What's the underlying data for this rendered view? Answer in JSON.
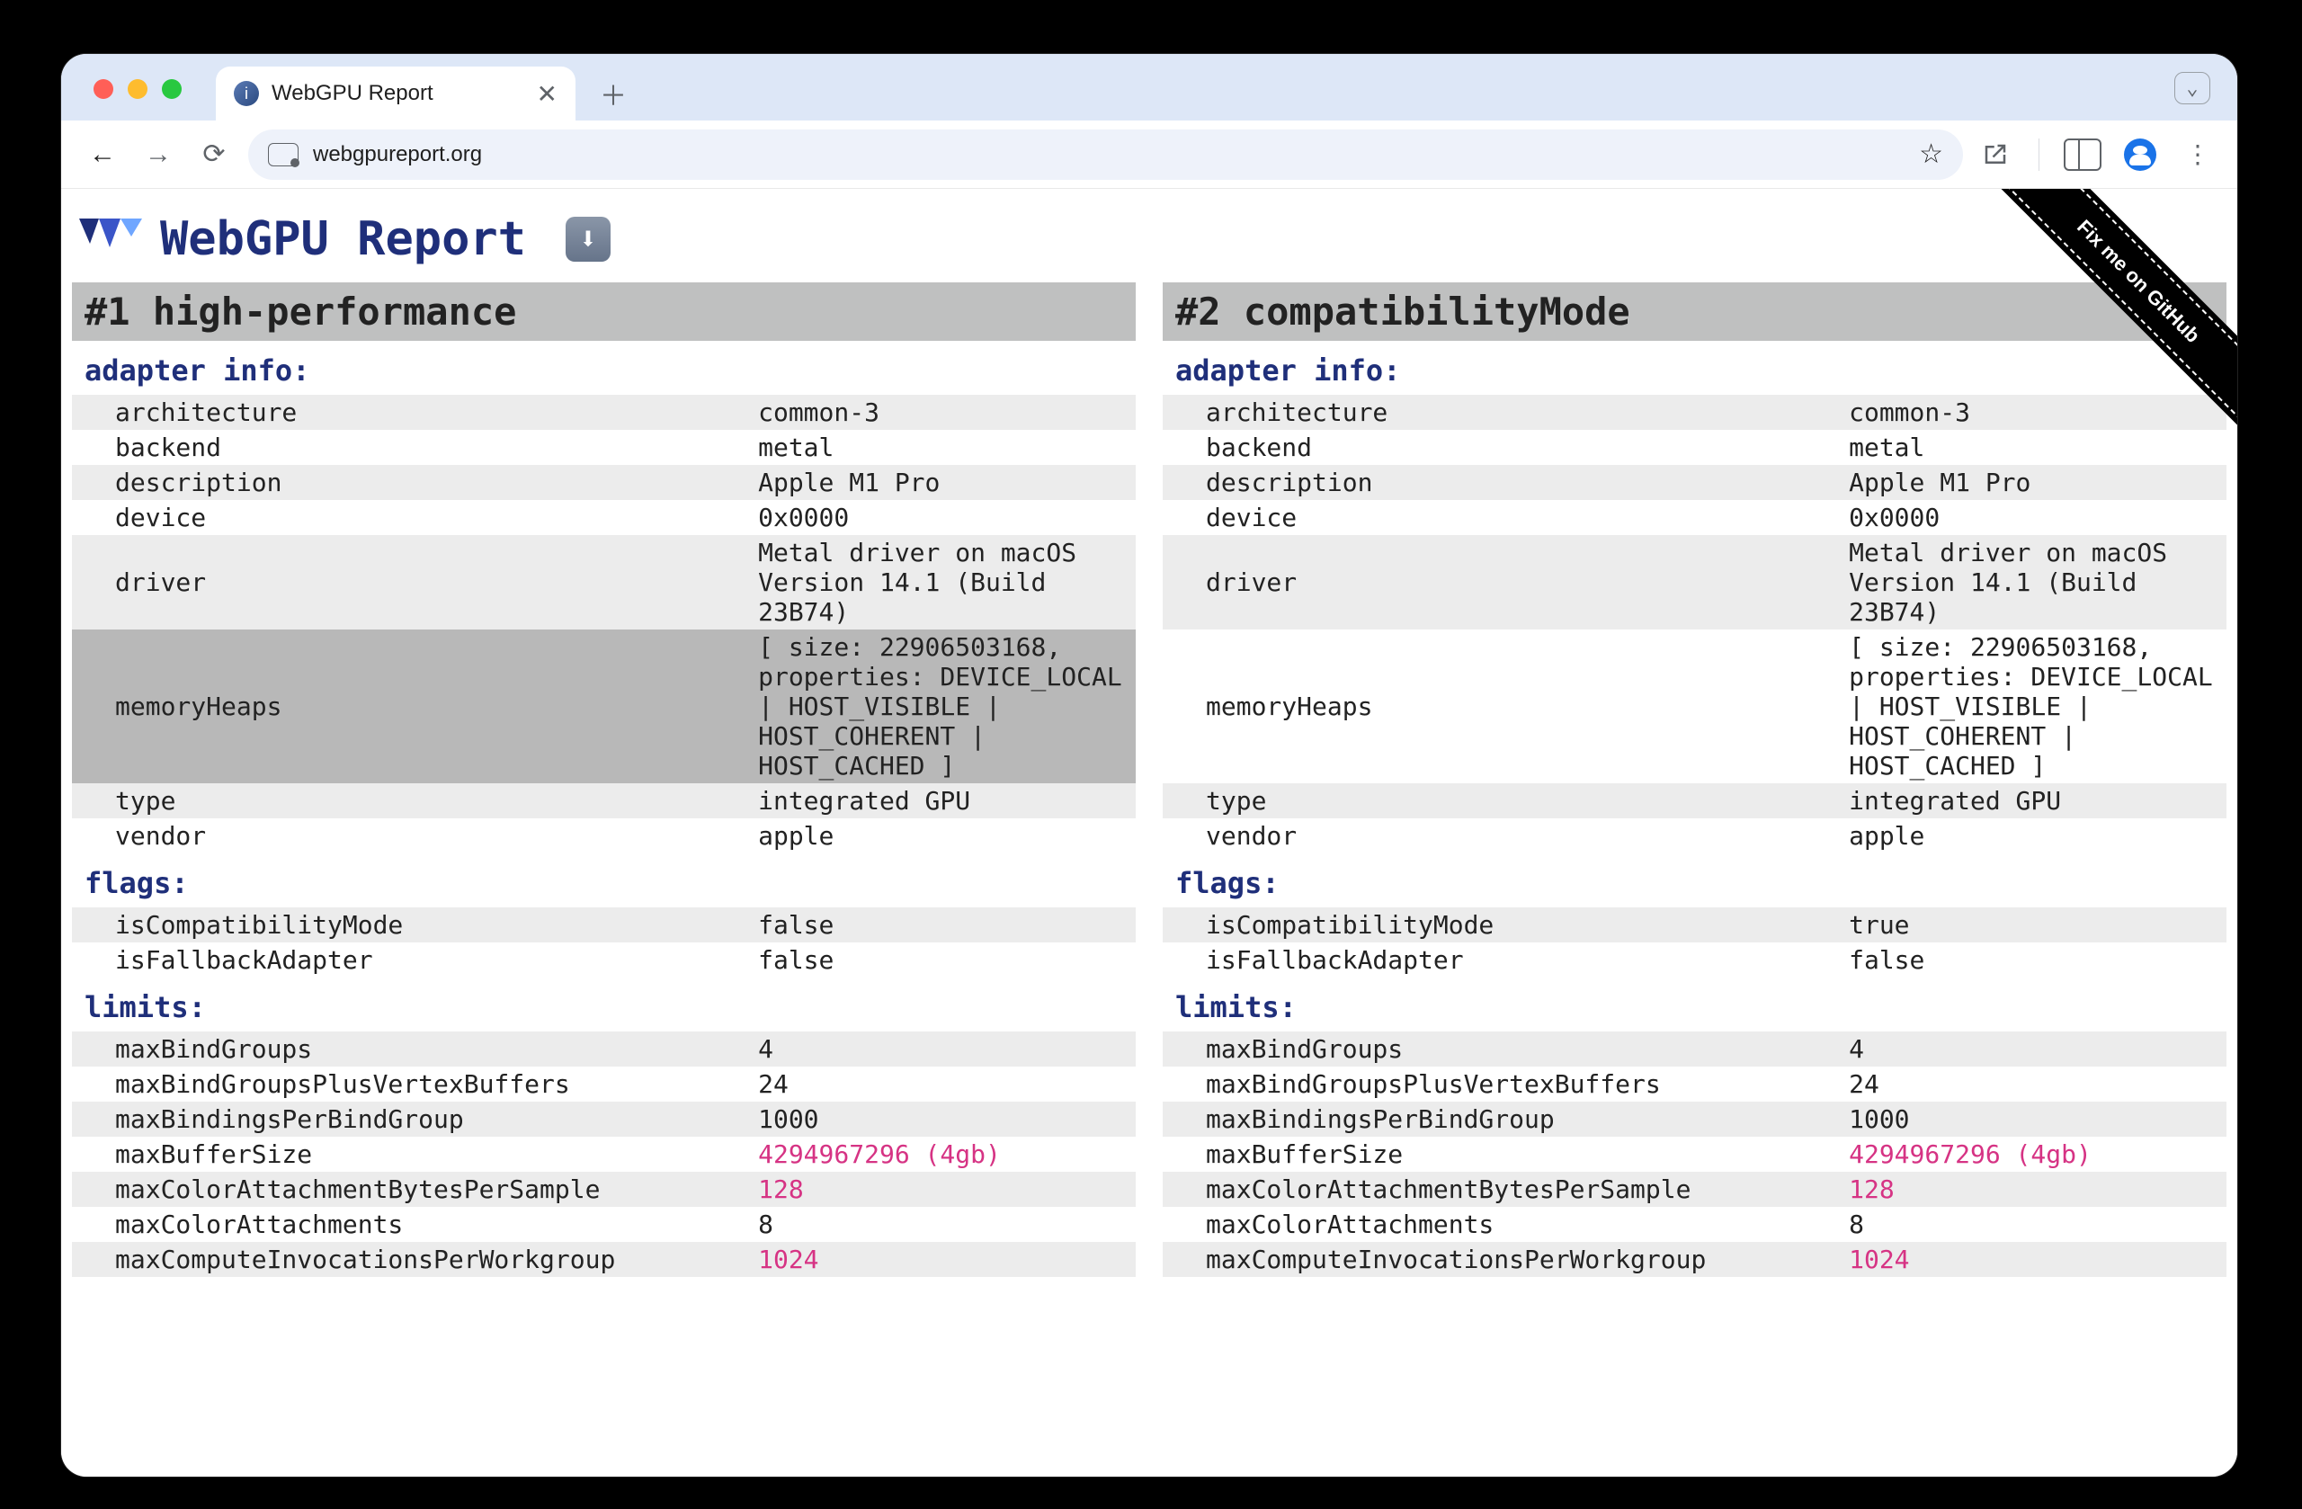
{
  "browser": {
    "tab_title": "WebGPU Report",
    "url": "webgpureport.org",
    "window_menu": "⌄"
  },
  "page": {
    "title": "WebGPU Report",
    "download_icon": "⬇",
    "ribbon": "Fix me on GitHub"
  },
  "columns": [
    {
      "header": "#1 high-performance",
      "sections": {
        "adapter_info_label": "adapter info:",
        "adapter_info": [
          {
            "k": "architecture",
            "v": "common-3"
          },
          {
            "k": "backend",
            "v": "metal"
          },
          {
            "k": "description",
            "v": "Apple M1 Pro"
          },
          {
            "k": "device",
            "v": "0x0000"
          },
          {
            "k": "driver",
            "v": "Metal driver on macOS Version 14.1 (Build 23B74)"
          },
          {
            "k": "memoryHeaps",
            "v": "[ size: 22906503168, properties: DEVICE_LOCAL | HOST_VISIBLE | HOST_COHERENT | HOST_CACHED ]",
            "hl": true
          },
          {
            "k": "type",
            "v": "integrated GPU"
          },
          {
            "k": "vendor",
            "v": "apple"
          }
        ],
        "flags_label": "flags:",
        "flags": [
          {
            "k": "isCompatibilityMode",
            "v": "false"
          },
          {
            "k": "isFallbackAdapter",
            "v": "false"
          }
        ],
        "limits_label": "limits:",
        "limits": [
          {
            "k": "maxBindGroups",
            "v": "4"
          },
          {
            "k": "maxBindGroupsPlusVertexBuffers",
            "v": "24"
          },
          {
            "k": "maxBindingsPerBindGroup",
            "v": "1000"
          },
          {
            "k": "maxBufferSize",
            "v": "4294967296 (4gb)",
            "pink": true
          },
          {
            "k": "maxColorAttachmentBytesPerSample",
            "v": "128",
            "pink": true
          },
          {
            "k": "maxColorAttachments",
            "v": "8"
          },
          {
            "k": "maxComputeInvocationsPerWorkgroup",
            "v": "1024",
            "pink": true
          }
        ]
      }
    },
    {
      "header": "#2 compatibilityMode",
      "sections": {
        "adapter_info_label": "adapter info:",
        "adapter_info": [
          {
            "k": "architecture",
            "v": "common-3"
          },
          {
            "k": "backend",
            "v": "metal"
          },
          {
            "k": "description",
            "v": "Apple M1 Pro"
          },
          {
            "k": "device",
            "v": "0x0000"
          },
          {
            "k": "driver",
            "v": "Metal driver on macOS Version 14.1 (Build 23B74)"
          },
          {
            "k": "memoryHeaps",
            "v": "[ size: 22906503168, properties: DEVICE_LOCAL | HOST_VISIBLE | HOST_COHERENT | HOST_CACHED ]"
          },
          {
            "k": "type",
            "v": "integrated GPU"
          },
          {
            "k": "vendor",
            "v": "apple"
          }
        ],
        "flags_label": "flags:",
        "flags": [
          {
            "k": "isCompatibilityMode",
            "v": "true"
          },
          {
            "k": "isFallbackAdapter",
            "v": "false"
          }
        ],
        "limits_label": "limits:",
        "limits": [
          {
            "k": "maxBindGroups",
            "v": "4"
          },
          {
            "k": "maxBindGroupsPlusVertexBuffers",
            "v": "24"
          },
          {
            "k": "maxBindingsPerBindGroup",
            "v": "1000"
          },
          {
            "k": "maxBufferSize",
            "v": "4294967296 (4gb)",
            "pink": true
          },
          {
            "k": "maxColorAttachmentBytesPerSample",
            "v": "128",
            "pink": true
          },
          {
            "k": "maxColorAttachments",
            "v": "8"
          },
          {
            "k": "maxComputeInvocationsPerWorkgroup",
            "v": "1024",
            "pink": true
          }
        ]
      }
    }
  ]
}
